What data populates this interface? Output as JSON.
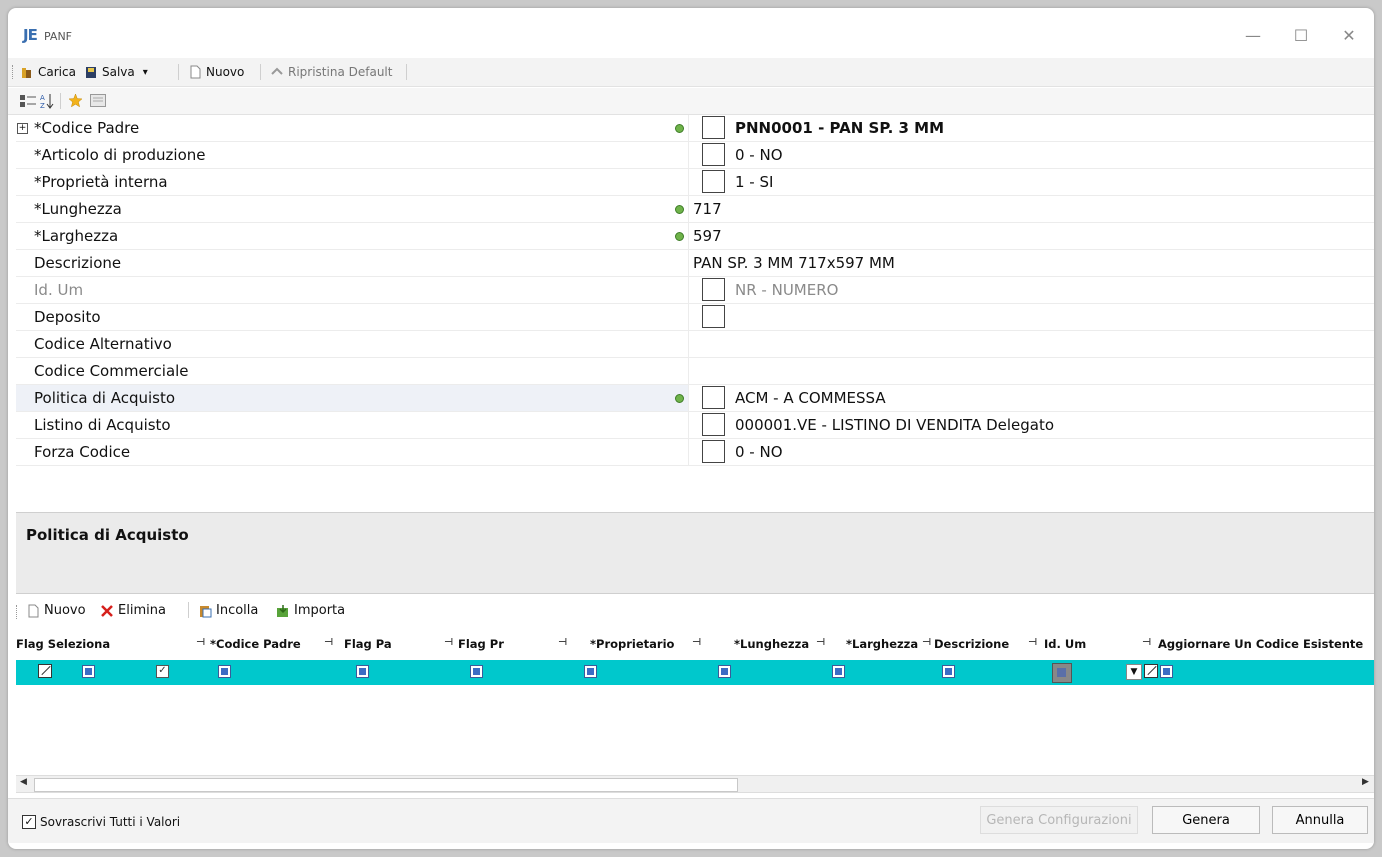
{
  "window": {
    "logo": "JE",
    "title": "PANF",
    "minimize": "—",
    "maximize": "☐",
    "close": "✕"
  },
  "toolbar": {
    "carica": "Carica",
    "salva": "Salva",
    "salva_arrow": "▾",
    "nuovo": "Nuovo",
    "ripristina": "Ripristina Default"
  },
  "properties": [
    {
      "label": "*Codice Padre",
      "value": "PNN0001 - PAN SP. 3 MM"
    },
    {
      "label": "*Articolo di produzione",
      "value": "0 - NO"
    },
    {
      "label": "*Proprietà interna",
      "value": "1 - SI"
    },
    {
      "label": "*Lunghezza",
      "value": "717"
    },
    {
      "label": "*Larghezza",
      "value": "597"
    },
    {
      "label": "Descrizione",
      "value": "PAN SP. 3 MM 717x597 MM"
    },
    {
      "label": "Id. Um",
      "value": "NR - NUMERO"
    },
    {
      "label": "Deposito",
      "value": ""
    },
    {
      "label": "Codice Alternativo",
      "value": ""
    },
    {
      "label": "Codice Commerciale",
      "value": ""
    },
    {
      "label": "Politica di Acquisto",
      "value": "ACM - A COMMESSA"
    },
    {
      "label": "Listino di Acquisto",
      "value": "000001.VE - LISTINO DI VENDITA Delegato"
    },
    {
      "label": "Forza Codice",
      "value": "0 - NO"
    }
  ],
  "description_panel": {
    "title": "Politica di Acquisto"
  },
  "grid_toolbar": {
    "nuovo": "Nuovo",
    "elimina": "Elimina",
    "incolla": "Incolla",
    "importa": "Importa"
  },
  "grid": {
    "columns": [
      "Flag Seleziona",
      "*Codice Padre",
      "Flag Pa",
      "Flag Pr",
      "*Proprietario",
      "*Lunghezza",
      "*Larghezza",
      "Descrizione",
      "Id. Um",
      "Aggiornare Un Codice Esistente"
    ],
    "pin_glyph": "⊣"
  },
  "footer": {
    "overwrite_label": "Sovrascrivi Tutti i Valori",
    "overwrite_checked": "✓",
    "genera_configurazioni": "Genera Configurazioni",
    "genera": "Genera",
    "annulla": "Annulla"
  },
  "colors": {
    "selected_row": "#00c8cc",
    "accent": "#3a6fb0"
  }
}
